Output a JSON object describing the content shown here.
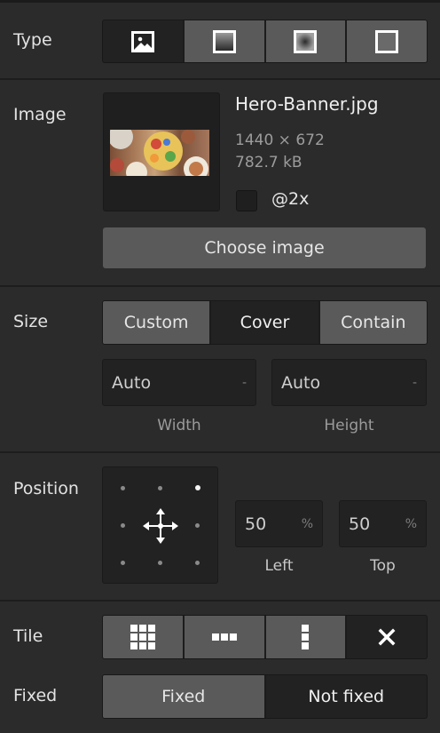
{
  "colors": {
    "panel_bg": "#2b2b2b",
    "segment_inactive": "#5a5a5a",
    "segment_active": "#222222",
    "field_bg": "#222222",
    "divider": "#1d1d1d"
  },
  "type": {
    "label": "Type",
    "options": [
      {
        "icon": "image-icon",
        "active": true
      },
      {
        "icon": "linear-gradient-icon",
        "active": false
      },
      {
        "icon": "radial-gradient-icon",
        "active": false
      },
      {
        "icon": "solid-fill-icon",
        "active": false
      }
    ]
  },
  "image": {
    "label": "Image",
    "file_name": "Hero-Banner.jpg",
    "dimensions": "1440 × 672",
    "file_size": "782.7 kB",
    "retina_label": "@2x",
    "retina_checked": false,
    "choose_button": "Choose image"
  },
  "size": {
    "label": "Size",
    "options": [
      "Custom",
      "Cover",
      "Contain"
    ],
    "selected": "Cover",
    "width_value": "Auto",
    "width_unit": "-",
    "width_label": "Width",
    "height_value": "Auto",
    "height_unit": "-",
    "height_label": "Height"
  },
  "position": {
    "label": "Position",
    "selected_anchor": "top-right",
    "move_icon": "move-arrows-icon",
    "left_value": "50",
    "left_unit": "%",
    "left_label": "Left",
    "top_value": "50",
    "top_unit": "%",
    "top_label": "Top"
  },
  "tile": {
    "label": "Tile",
    "options": [
      {
        "icon": "tile-grid-icon",
        "active": false
      },
      {
        "icon": "tile-horizontal-icon",
        "active": false
      },
      {
        "icon": "tile-vertical-icon",
        "active": false
      },
      {
        "icon": "no-tile-icon",
        "active": true
      }
    ]
  },
  "fixed": {
    "label": "Fixed",
    "options": [
      "Fixed",
      "Not fixed"
    ],
    "selected": "Not fixed"
  }
}
